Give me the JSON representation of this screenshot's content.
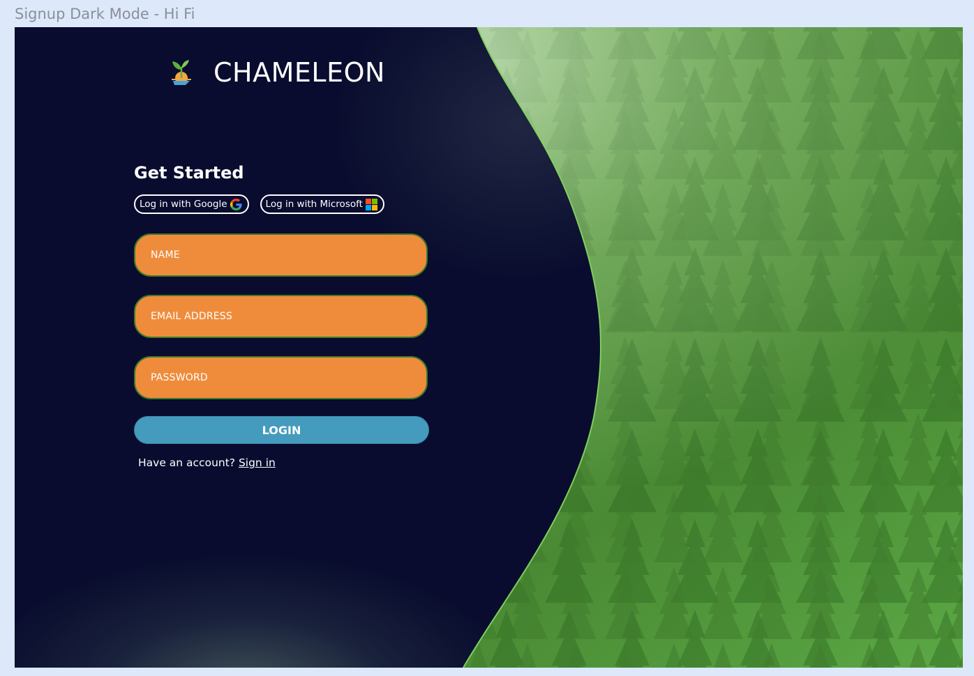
{
  "frame": {
    "label": "Signup Dark Mode - Hi Fi"
  },
  "brand": {
    "name": "CHAMELEON",
    "logo_icon": "sprout-sunrise-logo"
  },
  "form": {
    "title": "Get Started",
    "google_button": {
      "label": "Log in with Google",
      "icon": "google-icon"
    },
    "microsoft_button": {
      "label": "Log in with Microsoft",
      "icon": "microsoft-icon"
    },
    "fields": {
      "name": "NAME",
      "email": "EMAIL ADDRESS",
      "password": "PASSWORD"
    },
    "login_button": "LOGIN",
    "account_prompt": "Have an account?",
    "signin_link": "Sign in"
  },
  "colors": {
    "background_dark": "#090c2e",
    "field_orange": "#ef8c3c",
    "field_border": "#3d7a2a",
    "login_blue": "#459bbd",
    "forest_green": "#4f9a3a"
  }
}
